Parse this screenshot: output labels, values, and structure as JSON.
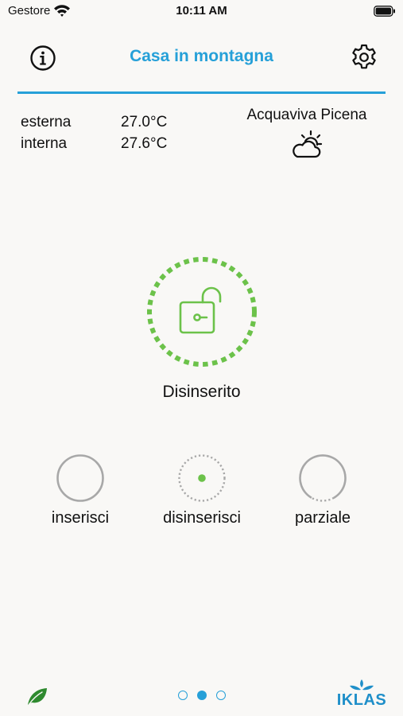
{
  "status_bar": {
    "carrier": "Gestore",
    "time": "10:11 AM"
  },
  "header": {
    "title": "Casa in montagna"
  },
  "temperatures": [
    {
      "label": "esterna",
      "value": "27.0°C"
    },
    {
      "label": "interna",
      "value": "27.6°C"
    }
  ],
  "weather": {
    "city": "Acquaviva Picena",
    "icon": "partly-cloudy-icon"
  },
  "system": {
    "status": "Disinserito",
    "status_color": "#6cc24a"
  },
  "actions": [
    {
      "label": "inserisci",
      "selected": false
    },
    {
      "label": "disinserisci",
      "selected": true
    },
    {
      "label": "parziale",
      "selected": false
    }
  ],
  "pager": {
    "count": 3,
    "active": 2
  },
  "brand": {
    "name": "IKLAS"
  },
  "colors": {
    "accent": "#26a0d8",
    "armed_ring": "#a8a8a8",
    "disarmed": "#6cc24a",
    "leaf": "#2f8a2f"
  }
}
